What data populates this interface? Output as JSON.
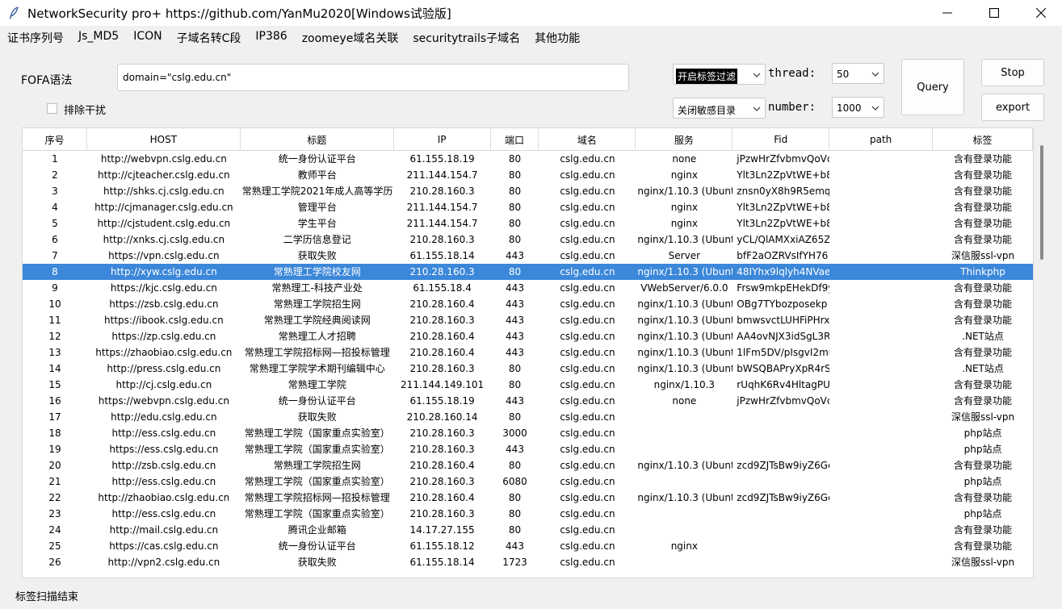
{
  "window": {
    "title": "NetworkSecurity pro+ https://github.com/YanMu2020[Windows试验版]"
  },
  "menu": [
    "证书序列号",
    "Js_MD5",
    "ICON",
    "子域名转C段",
    "IP386",
    "zoomeye域名关联",
    "securitytrails子域名",
    "其他功能"
  ],
  "form": {
    "fofa_label": "FOFA语法",
    "query_value": "domain=\"cslg.edu.cn\"",
    "exclude_label": "排除干扰",
    "tag_filter_value": "开启标签过滤",
    "sensitive_dir_value": "关闭敏感目录",
    "thread_label": "thread:",
    "thread_value": "50",
    "number_label": "number:",
    "number_value": "1000",
    "query_button": "Query",
    "stop_button": "Stop",
    "export_button": "export"
  },
  "table": {
    "headers": [
      "序号",
      "HOST",
      "标题",
      "IP",
      "端口",
      "域名",
      "服务",
      "Fid",
      "path",
      "标签"
    ],
    "selected_index": 7,
    "rows": [
      [
        "1",
        "http://webvpn.cslg.edu.cn",
        "统一身份认证平台",
        "61.155.18.19",
        "80",
        "cslg.edu.cn",
        "none",
        "jPzwHrZfvbmvQoVc",
        "",
        "含有登录功能"
      ],
      [
        "2",
        "http://cjteacher.cslg.edu.cn",
        "教师平台",
        "211.144.154.7",
        "80",
        "cslg.edu.cn",
        "nginx",
        "Ylt3Ln2ZpVtWE+b8",
        "",
        "含有登录功能"
      ],
      [
        "3",
        "http://shks.cj.cslg.edu.cn",
        "常熟理工学院2021年成人高等学历",
        "210.28.160.3",
        "80",
        "cslg.edu.cn",
        "nginx/1.10.3 (Ubunt",
        "znsn0yX8h9R5emql",
        "",
        "含有登录功能"
      ],
      [
        "4",
        "http://cjmanager.cslg.edu.cn",
        "管理平台",
        "211.144.154.7",
        "80",
        "cslg.edu.cn",
        "nginx",
        "Ylt3Ln2ZpVtWE+b8",
        "",
        "含有登录功能"
      ],
      [
        "5",
        "http://cjstudent.cslg.edu.cn",
        "学生平台",
        "211.144.154.7",
        "80",
        "cslg.edu.cn",
        "nginx",
        "Ylt3Ln2ZpVtWE+b8",
        "",
        "含有登录功能"
      ],
      [
        "6",
        "http://xnks.cj.cslg.edu.cn",
        "二学历信息登记",
        "210.28.160.3",
        "80",
        "cslg.edu.cn",
        "nginx/1.10.3 (Ubunt",
        "yCL/QlAMXxiAZ65Z",
        "",
        "含有登录功能"
      ],
      [
        "7",
        "https://vpn.cslg.edu.cn",
        "获取失败",
        "61.155.18.14",
        "443",
        "cslg.edu.cn",
        "Server",
        "bfF2aOZRVsIfYH76",
        "",
        "深信服ssl-vpn"
      ],
      [
        "8",
        "http://xyw.cslg.edu.cn",
        "常熟理工学院校友网",
        "210.28.160.3",
        "80",
        "cslg.edu.cn",
        "nginx/1.10.3 (Ubunt",
        "48IYhx9lqlyh4NVae",
        "",
        "Thinkphp"
      ],
      [
        "9",
        "https://kjc.cslg.edu.cn",
        "常熟理工-科技产业处",
        "61.155.18.4",
        "443",
        "cslg.edu.cn",
        "VWebServer/6.0.0",
        "Frsw9mkpEHekDf9y",
        "",
        "含有登录功能"
      ],
      [
        "10",
        "https://zsb.cslg.edu.cn",
        "常熟理工学院招生网",
        "210.28.160.4",
        "443",
        "cslg.edu.cn",
        "nginx/1.10.3 (Ubunt",
        "OBg7TYbozposekp",
        "",
        "含有登录功能"
      ],
      [
        "11",
        "https://ibook.cslg.edu.cn",
        "常熟理工学院经典阅读网",
        "210.28.160.3",
        "443",
        "cslg.edu.cn",
        "nginx/1.10.3 (Ubunt",
        "bmwsvctLUHFiPHrxl",
        "",
        "含有登录功能"
      ],
      [
        "12",
        "https://zp.cslg.edu.cn",
        "常熟理工人才招聘",
        "210.28.160.4",
        "443",
        "cslg.edu.cn",
        "nginx/1.10.3 (Ubunt",
        "AA4ovNJX3idSgL3R",
        "",
        ".NET站点"
      ],
      [
        "13",
        "https://zhaobiao.cslg.edu.cn",
        "常熟理工学院招标网—招投标管理",
        "210.28.160.4",
        "443",
        "cslg.edu.cn",
        "nginx/1.10.3 (Ubunt",
        "1lFm5DV/pIsgvI2mu",
        "",
        "含有登录功能"
      ],
      [
        "14",
        "http://press.cslg.edu.cn",
        "常熟理工学院学术期刊编辑中心",
        "210.28.160.3",
        "80",
        "cslg.edu.cn",
        "nginx/1.10.3 (Ubunt",
        "bWSQBAPryXpR4rS",
        "",
        ".NET站点"
      ],
      [
        "15",
        "http://cj.cslg.edu.cn",
        "常熟理工学院",
        "211.144.149.101",
        "80",
        "cslg.edu.cn",
        "nginx/1.10.3",
        "rUqhK6Rv4HltagPU",
        "",
        "含有登录功能"
      ],
      [
        "16",
        "https://webvpn.cslg.edu.cn",
        "统一身份认证平台",
        "61.155.18.19",
        "443",
        "cslg.edu.cn",
        "none",
        "jPzwHrZfvbmvQoVc",
        "",
        "含有登录功能"
      ],
      [
        "17",
        "http://edu.cslg.edu.cn",
        "获取失败",
        "210.28.160.14",
        "80",
        "cslg.edu.cn",
        "",
        "",
        "",
        "深信服ssl-vpn"
      ],
      [
        "18",
        "http://ess.cslg.edu.cn",
        "常熟理工学院（国家重点实验室）",
        "210.28.160.3",
        "3000",
        "cslg.edu.cn",
        "",
        "",
        "",
        "php站点"
      ],
      [
        "19",
        "https://ess.cslg.edu.cn",
        "常熟理工学院（国家重点实验室）",
        "210.28.160.3",
        "443",
        "cslg.edu.cn",
        "",
        "",
        "",
        "php站点"
      ],
      [
        "20",
        "http://zsb.cslg.edu.cn",
        "常熟理工学院招生网",
        "210.28.160.4",
        "80",
        "cslg.edu.cn",
        "nginx/1.10.3 (Ubunt",
        "zcd9ZJTsBw9iyZ6Gc",
        "",
        "含有登录功能"
      ],
      [
        "21",
        "http://ess.cslg.edu.cn",
        "常熟理工学院（国家重点实验室）",
        "210.28.160.3",
        "6080",
        "cslg.edu.cn",
        "",
        "",
        "",
        "php站点"
      ],
      [
        "22",
        "http://zhaobiao.cslg.edu.cn",
        "常熟理工学院招标网—招投标管理",
        "210.28.160.4",
        "80",
        "cslg.edu.cn",
        "nginx/1.10.3 (Ubunt",
        "zcd9ZJTsBw9iyZ6Gc",
        "",
        "含有登录功能"
      ],
      [
        "23",
        "http://ess.cslg.edu.cn",
        "常熟理工学院（国家重点实验室）",
        "210.28.160.3",
        "80",
        "cslg.edu.cn",
        "",
        "",
        "",
        "php站点"
      ],
      [
        "24",
        "http://mail.cslg.edu.cn",
        "腾讯企业邮箱",
        "14.17.27.155",
        "80",
        "cslg.edu.cn",
        "",
        "",
        "",
        "含有登录功能"
      ],
      [
        "25",
        "https://cas.cslg.edu.cn",
        "统一身份认证平台",
        "61.155.18.12",
        "443",
        "cslg.edu.cn",
        "nginx",
        "",
        "",
        "含有登录功能"
      ],
      [
        "26",
        "http://vpn2.cslg.edu.cn",
        "获取失败",
        "61.155.18.14",
        "1723",
        "cslg.edu.cn",
        "",
        "",
        "",
        "深信服ssl-vpn"
      ]
    ]
  },
  "status": "标签扫描结束"
}
